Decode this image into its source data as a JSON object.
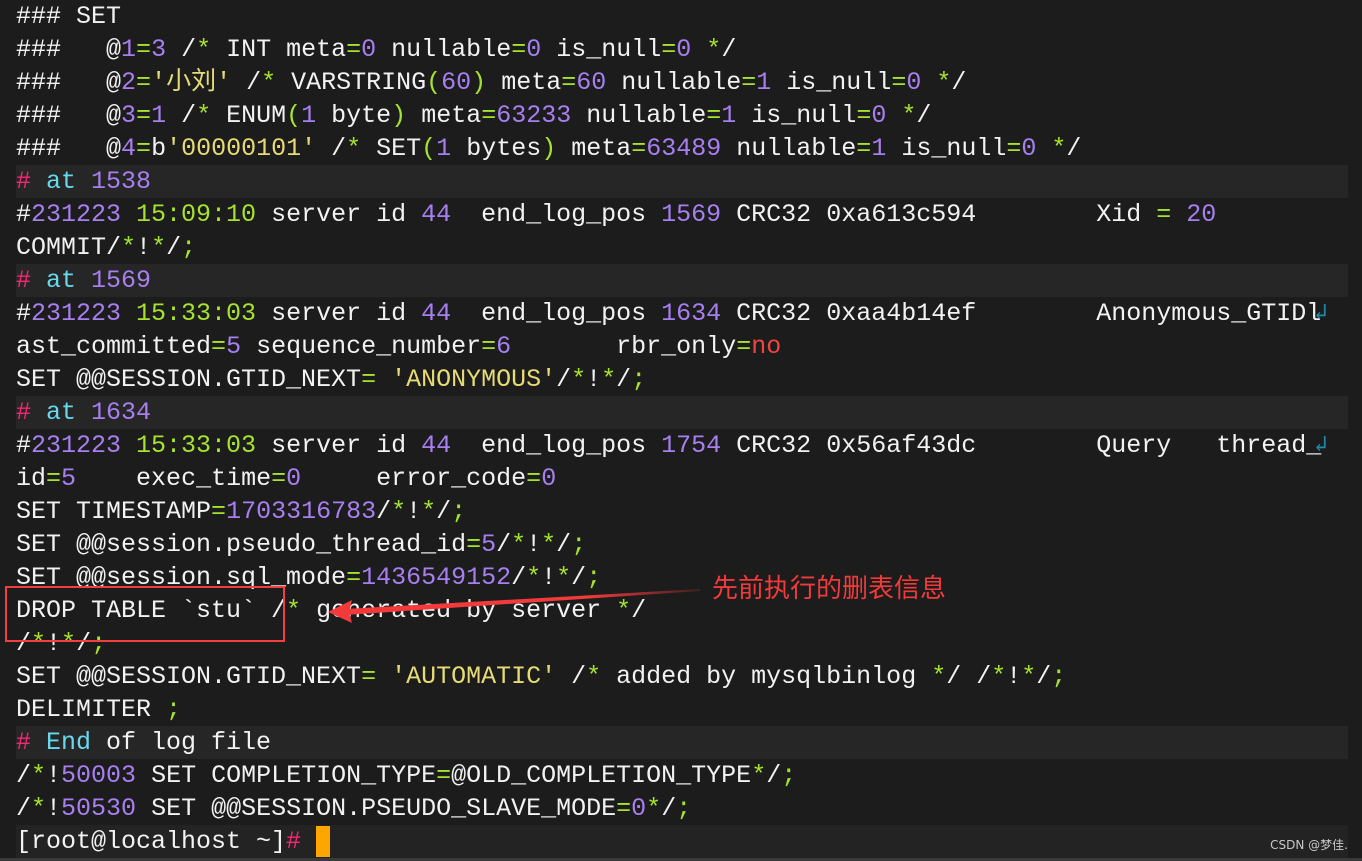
{
  "terminal": {
    "lines": [
      {
        "hl": false,
        "segs": [
          [
            "w",
            "### SET"
          ]
        ]
      },
      {
        "hl": false,
        "segs": [
          [
            "w",
            "###   @"
          ],
          [
            "n",
            "1"
          ],
          [
            "g",
            "="
          ],
          [
            "n",
            "3"
          ],
          [
            "w",
            " /"
          ],
          [
            "g",
            "*"
          ],
          [
            "w",
            " INT meta"
          ],
          [
            "g",
            "="
          ],
          [
            "n",
            "0"
          ],
          [
            "w",
            " nullable"
          ],
          [
            "g",
            "="
          ],
          [
            "n",
            "0"
          ],
          [
            "w",
            " is_null"
          ],
          [
            "g",
            "="
          ],
          [
            "n",
            "0"
          ],
          [
            "g",
            " *"
          ],
          [
            "w",
            "/"
          ]
        ]
      },
      {
        "hl": false,
        "segs": [
          [
            "w",
            "###   @"
          ],
          [
            "n",
            "2"
          ],
          [
            "g",
            "="
          ],
          [
            "y",
            "'小刘'"
          ],
          [
            "w",
            " /"
          ],
          [
            "g",
            "*"
          ],
          [
            "w",
            " VARSTRING"
          ],
          [
            "g",
            "("
          ],
          [
            "n",
            "60"
          ],
          [
            "g",
            ")"
          ],
          [
            "w",
            " meta"
          ],
          [
            "g",
            "="
          ],
          [
            "n",
            "60"
          ],
          [
            "w",
            " nullable"
          ],
          [
            "g",
            "="
          ],
          [
            "n",
            "1"
          ],
          [
            "w",
            " is_null"
          ],
          [
            "g",
            "="
          ],
          [
            "n",
            "0"
          ],
          [
            "g",
            " *"
          ],
          [
            "w",
            "/"
          ]
        ]
      },
      {
        "hl": false,
        "segs": [
          [
            "w",
            "###   @"
          ],
          [
            "n",
            "3"
          ],
          [
            "g",
            "="
          ],
          [
            "n",
            "1"
          ],
          [
            "w",
            " /"
          ],
          [
            "g",
            "*"
          ],
          [
            "w",
            " ENUM"
          ],
          [
            "g",
            "("
          ],
          [
            "n",
            "1"
          ],
          [
            "w",
            " byte"
          ],
          [
            "g",
            ")"
          ],
          [
            "w",
            " meta"
          ],
          [
            "g",
            "="
          ],
          [
            "n",
            "63233"
          ],
          [
            "w",
            " nullable"
          ],
          [
            "g",
            "="
          ],
          [
            "n",
            "1"
          ],
          [
            "w",
            " is_null"
          ],
          [
            "g",
            "="
          ],
          [
            "n",
            "0"
          ],
          [
            "g",
            " *"
          ],
          [
            "w",
            "/"
          ]
        ]
      },
      {
        "hl": false,
        "segs": [
          [
            "w",
            "###   @"
          ],
          [
            "n",
            "4"
          ],
          [
            "g",
            "="
          ],
          [
            "w",
            "b"
          ],
          [
            "y",
            "'00000101'"
          ],
          [
            "w",
            " /"
          ],
          [
            "g",
            "*"
          ],
          [
            "w",
            " SET"
          ],
          [
            "g",
            "("
          ],
          [
            "n",
            "1"
          ],
          [
            "w",
            " bytes"
          ],
          [
            "g",
            ")"
          ],
          [
            "w",
            " meta"
          ],
          [
            "g",
            "="
          ],
          [
            "n",
            "63489"
          ],
          [
            "w",
            " nullable"
          ],
          [
            "g",
            "="
          ],
          [
            "n",
            "1"
          ],
          [
            "w",
            " is_null"
          ],
          [
            "g",
            "="
          ],
          [
            "n",
            "0"
          ],
          [
            "g",
            " *"
          ],
          [
            "w",
            "/"
          ]
        ]
      },
      {
        "hl": true,
        "segs": [
          [
            "r",
            "#"
          ],
          [
            "c",
            " at"
          ],
          [
            "n",
            " 1538"
          ]
        ]
      },
      {
        "hl": false,
        "segs": [
          [
            "w",
            "#"
          ],
          [
            "n",
            "231223"
          ],
          [
            "g",
            " 15:09:10"
          ],
          [
            "w",
            " server id"
          ],
          [
            "n",
            " 44"
          ],
          [
            "w",
            "  end_log_pos"
          ],
          [
            "n",
            " 1569"
          ],
          [
            "w",
            " CRC32 0xa613c594        Xid "
          ],
          [
            "g",
            "="
          ],
          [
            "n",
            " 20"
          ]
        ]
      },
      {
        "hl": false,
        "segs": [
          [
            "w",
            "COMMIT/"
          ],
          [
            "g",
            "*"
          ],
          [
            "w",
            "!"
          ],
          [
            "g",
            "*"
          ],
          [
            "w",
            "/"
          ],
          [
            "g",
            ";"
          ]
        ]
      },
      {
        "hl": true,
        "segs": [
          [
            "r",
            "#"
          ],
          [
            "c",
            " at"
          ],
          [
            "n",
            " 1569"
          ]
        ]
      },
      {
        "hl": false,
        "wrap": true,
        "segs": [
          [
            "w",
            "#"
          ],
          [
            "n",
            "231223"
          ],
          [
            "g",
            " 15:33:03"
          ],
          [
            "w",
            " server id"
          ],
          [
            "n",
            " 44"
          ],
          [
            "w",
            "  end_log_pos"
          ],
          [
            "n",
            " 1634"
          ],
          [
            "w",
            " CRC32 0xaa4b14ef        Anonymous_GTIDl"
          ]
        ]
      },
      {
        "hl": false,
        "segs": [
          [
            "w",
            "ast_committed"
          ],
          [
            "g",
            "="
          ],
          [
            "n",
            "5"
          ],
          [
            "w",
            " sequence_number"
          ],
          [
            "g",
            "="
          ],
          [
            "n",
            "6"
          ],
          [
            "w",
            "       rbr_only"
          ],
          [
            "g",
            "="
          ],
          [
            "x",
            "no"
          ]
        ]
      },
      {
        "hl": false,
        "segs": [
          [
            "w",
            "SET @@SESSION.GTID_NEXT"
          ],
          [
            "g",
            "="
          ],
          [
            "y",
            " 'ANONYMOUS'"
          ],
          [
            "w",
            "/"
          ],
          [
            "g",
            "*"
          ],
          [
            "w",
            "!"
          ],
          [
            "g",
            "*"
          ],
          [
            "w",
            "/"
          ],
          [
            "g",
            ";"
          ]
        ]
      },
      {
        "hl": true,
        "segs": [
          [
            "r",
            "#"
          ],
          [
            "c",
            " at"
          ],
          [
            "n",
            " 1634"
          ]
        ]
      },
      {
        "hl": false,
        "wrap": true,
        "segs": [
          [
            "w",
            "#"
          ],
          [
            "n",
            "231223"
          ],
          [
            "g",
            " 15:33:03"
          ],
          [
            "w",
            " server id"
          ],
          [
            "n",
            " 44"
          ],
          [
            "w",
            "  end_log_pos"
          ],
          [
            "n",
            " 1754"
          ],
          [
            "w",
            " CRC32 0x56af43dc        Query   thread_"
          ]
        ]
      },
      {
        "hl": false,
        "segs": [
          [
            "w",
            "id"
          ],
          [
            "g",
            "="
          ],
          [
            "n",
            "5"
          ],
          [
            "w",
            "    exec_time"
          ],
          [
            "g",
            "="
          ],
          [
            "n",
            "0"
          ],
          [
            "w",
            "     error_code"
          ],
          [
            "g",
            "="
          ],
          [
            "n",
            "0"
          ]
        ]
      },
      {
        "hl": false,
        "segs": [
          [
            "w",
            "SET TIMESTAMP"
          ],
          [
            "g",
            "="
          ],
          [
            "n",
            "1703316783"
          ],
          [
            "w",
            "/"
          ],
          [
            "g",
            "*"
          ],
          [
            "w",
            "!"
          ],
          [
            "g",
            "*"
          ],
          [
            "w",
            "/"
          ],
          [
            "g",
            ";"
          ]
        ]
      },
      {
        "hl": false,
        "segs": [
          [
            "w",
            "SET @@session.pseudo_thread_id"
          ],
          [
            "g",
            "="
          ],
          [
            "n",
            "5"
          ],
          [
            "w",
            "/"
          ],
          [
            "g",
            "*"
          ],
          [
            "w",
            "!"
          ],
          [
            "g",
            "*"
          ],
          [
            "w",
            "/"
          ],
          [
            "g",
            ";"
          ]
        ]
      },
      {
        "hl": false,
        "segs": [
          [
            "w",
            "SET @@session.sql_mode"
          ],
          [
            "g",
            "="
          ],
          [
            "n",
            "1436549152"
          ],
          [
            "w",
            "/"
          ],
          [
            "g",
            "*"
          ],
          [
            "w",
            "!"
          ],
          [
            "g",
            "*"
          ],
          [
            "w",
            "/"
          ],
          [
            "g",
            ";"
          ]
        ]
      },
      {
        "hl": false,
        "segs": [
          [
            "w",
            "DROP TABLE `stu` /"
          ],
          [
            "g",
            "*"
          ],
          [
            "w",
            " generated by server"
          ],
          [
            "g",
            " *"
          ],
          [
            "w",
            "/"
          ]
        ]
      },
      {
        "hl": false,
        "segs": [
          [
            "w",
            "/"
          ],
          [
            "g",
            "*"
          ],
          [
            "w",
            "!"
          ],
          [
            "g",
            "*"
          ],
          [
            "w",
            "/"
          ],
          [
            "g",
            ";"
          ]
        ]
      },
      {
        "hl": false,
        "segs": [
          [
            "w",
            "SET @@SESSION.GTID_NEXT"
          ],
          [
            "g",
            "="
          ],
          [
            "y",
            " 'AUTOMATIC'"
          ],
          [
            "w",
            " /"
          ],
          [
            "g",
            "*"
          ],
          [
            "w",
            " added by mysqlbinlog"
          ],
          [
            "g",
            " *"
          ],
          [
            "w",
            "/ /"
          ],
          [
            "g",
            "*"
          ],
          [
            "w",
            "!"
          ],
          [
            "g",
            "*"
          ],
          [
            "w",
            "/"
          ],
          [
            "g",
            ";"
          ]
        ]
      },
      {
        "hl": false,
        "segs": [
          [
            "w",
            "DELIMITER"
          ],
          [
            "g",
            " ;"
          ]
        ]
      },
      {
        "hl": true,
        "segs": [
          [
            "r",
            "#"
          ],
          [
            "c",
            " End"
          ],
          [
            "w",
            " of log file"
          ]
        ]
      },
      {
        "hl": false,
        "segs": [
          [
            "w",
            "/"
          ],
          [
            "g",
            "*"
          ],
          [
            "w",
            "!"
          ],
          [
            "n",
            "50003"
          ],
          [
            "w",
            " SET COMPLETION_TYPE"
          ],
          [
            "g",
            "="
          ],
          [
            "w",
            "@OLD_COMPLETION_TYPE"
          ],
          [
            "g",
            "*"
          ],
          [
            "w",
            "/"
          ],
          [
            "g",
            ";"
          ]
        ]
      },
      {
        "hl": false,
        "segs": [
          [
            "w",
            "/"
          ],
          [
            "g",
            "*"
          ],
          [
            "w",
            "!"
          ],
          [
            "n",
            "50530"
          ],
          [
            "w",
            " SET @@SESSION.PSEUDO_SLAVE_MODE"
          ],
          [
            "g",
            "="
          ],
          [
            "n",
            "0"
          ],
          [
            "g",
            "*"
          ],
          [
            "w",
            "/"
          ],
          [
            "g",
            ";"
          ]
        ]
      }
    ],
    "prompt": {
      "text": "[root@localhost ~]",
      "symbol": "#"
    }
  },
  "annotation": {
    "label": "先前执行的删表信息",
    "color": "#f23a3a"
  },
  "watermark": "CSDN @梦佳."
}
